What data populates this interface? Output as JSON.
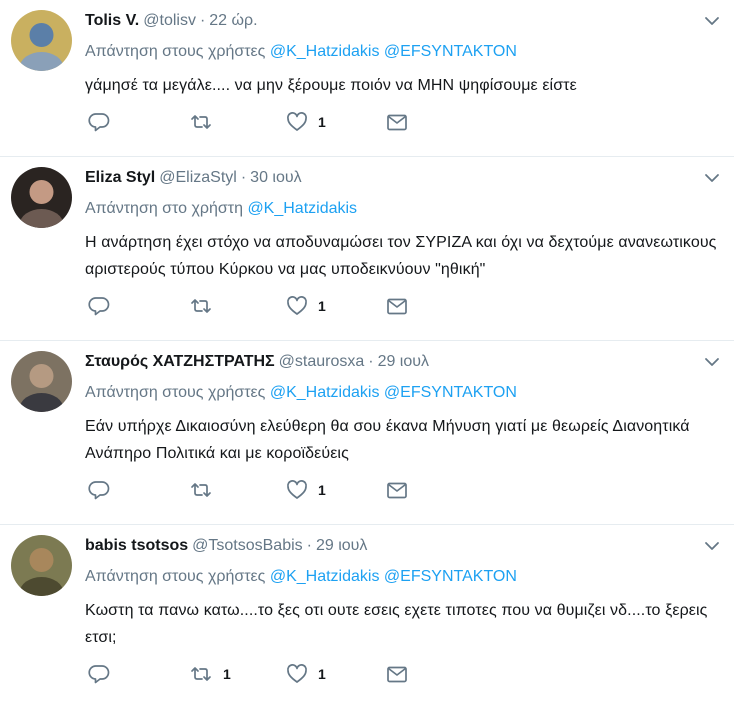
{
  "tweets": [
    {
      "fullname": "Tolis V.",
      "handle": "@tolisv",
      "sep": "·",
      "time": "22 ώρ.",
      "replying_prefix": "Απάντηση στους χρήστες",
      "mentions": [
        "@K_Hatzidakis",
        "@EFSYNTAKTON"
      ],
      "text": "γάμησέ τα μεγάλε.... να μην ξέρουμε ποιόν να ΜΗΝ ψηφίσουμε είστε",
      "retweets": "",
      "likes": "1",
      "avatar_colors": [
        "#c9b060",
        "#5b7fa8",
        "#8aa0b8"
      ]
    },
    {
      "fullname": "Eliza Styl",
      "handle": "@ElizaStyl",
      "sep": "·",
      "time": "30 ιουλ",
      "replying_prefix": "Απάντηση στο χρήστη",
      "mentions": [
        "@K_Hatzidakis"
      ],
      "text": "Η ανάρτηση έχει στόχο να αποδυναμώσει τον ΣΥΡΙΖΑ και όχι να δεχτούμε ανανεωτικους αριστερούς τύπου Κύρκου να μας υποδεικνύουν \"ηθική\"",
      "retweets": "",
      "likes": "1",
      "avatar_colors": [
        "#2a2421",
        "#c49a84",
        "#6c5a52"
      ]
    },
    {
      "fullname": "Σταυρός ΧΑΤΖΗΣΤΡΑΤΗΣ",
      "handle": "@staurosxa",
      "sep": "·",
      "time": "29 ιουλ",
      "replying_prefix": "Απάντηση στους χρήστες",
      "mentions": [
        "@K_Hatzidakis",
        "@EFSYNTAKTON"
      ],
      "text": "Εάν υπήρχε Δικαιοσύνη ελεύθερη θα σου έκανα Μήνυση γιατί με θεωρείς Διανοητικά Ανάπηρο Πολιτικά και με κοροϊδεύεις",
      "retweets": "",
      "likes": "1",
      "avatar_colors": [
        "#7d7262",
        "#b59a82",
        "#3a3a40"
      ]
    },
    {
      "fullname": "babis tsotsos",
      "handle": "@TsotsosBabis",
      "sep": "·",
      "time": "29 ιουλ",
      "replying_prefix": "Απάντηση στους χρήστες",
      "mentions": [
        "@K_Hatzidakis",
        "@EFSYNTAKTON"
      ],
      "text": "Κωστη τα πανω κατω....το ξες οτι ουτε εσεις εχετε τιποτες που να θυμιζει νδ....το ξερεις ετσι;",
      "retweets": "1",
      "likes": "1",
      "avatar_colors": [
        "#7c7a52",
        "#a8875c",
        "#4d4a30"
      ]
    }
  ]
}
